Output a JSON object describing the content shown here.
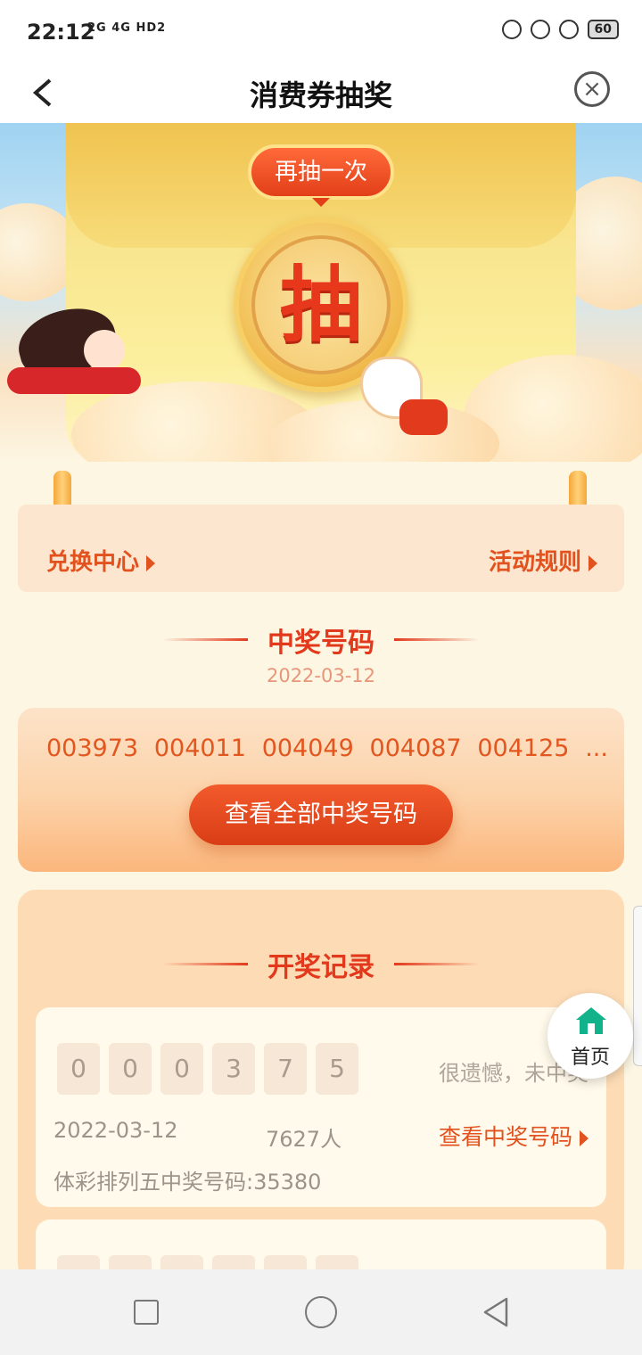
{
  "status_bar": {
    "time": "22:12",
    "network": "2G 4G HD2",
    "battery": "60"
  },
  "header": {
    "back_icon": "chevron-left-icon",
    "title": "消费券抽奖",
    "close_icon": "close-circle-icon"
  },
  "hero": {
    "again_label": "再抽一次",
    "draw_label": "抽"
  },
  "scroll_banner": {
    "exchange_label": "兑换中心",
    "rules_label": "活动规则"
  },
  "winning": {
    "heading": "中奖号码",
    "date": "2022-03-12",
    "numbers": [
      "003973",
      "004011",
      "004049",
      "004087",
      "004125",
      "..."
    ],
    "view_all_label": "查看全部中奖号码"
  },
  "records": {
    "heading": "开奖记录",
    "items": [
      {
        "digits": [
          "0",
          "0",
          "0",
          "3",
          "7",
          "5"
        ],
        "result": "很遗憾，未中奖",
        "date": "2022-03-12",
        "participants": "7627人",
        "link_label": "查看中奖号码",
        "description": "体彩排列五中奖号码:35380"
      }
    ]
  },
  "floating_home": {
    "label": "首页",
    "icon": "home-icon",
    "color": "#12b38a"
  },
  "colors": {
    "accent": "#e2391c",
    "link": "#e2521f",
    "page_bg": "#fdf6e3"
  }
}
